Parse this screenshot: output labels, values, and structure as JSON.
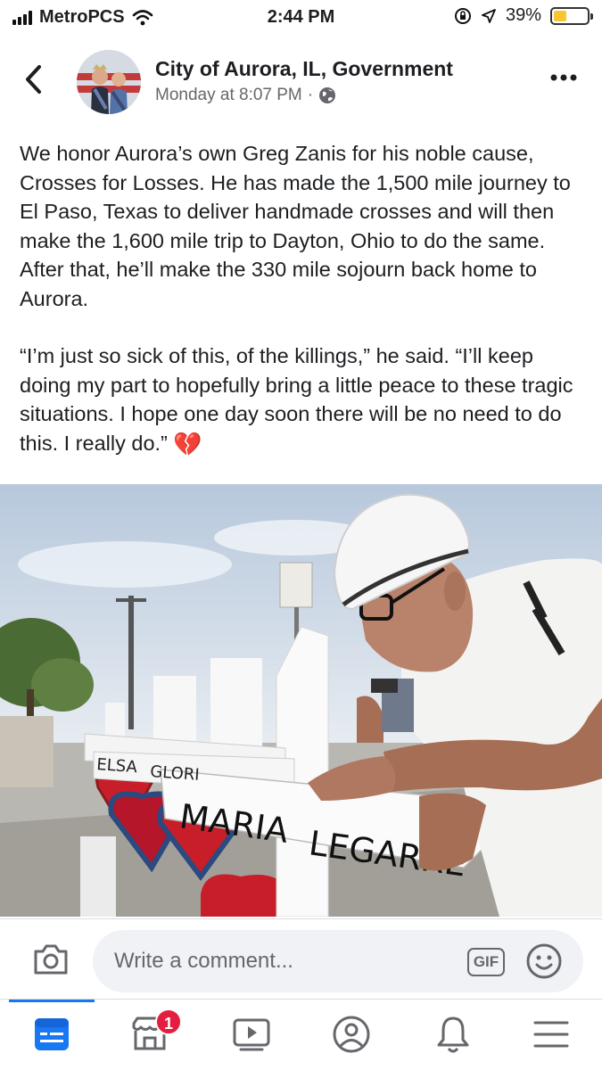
{
  "status_bar": {
    "carrier": "MetroPCS",
    "time": "2:44 PM",
    "battery": "39%",
    "battery_level": 0.39,
    "icons": [
      "signal-icon",
      "wifi-icon",
      "orientation-lock-icon",
      "location-icon",
      "battery-icon"
    ]
  },
  "header": {
    "page_name": "City of Aurora, IL, Government",
    "timestamp": "Monday at 8:07 PM",
    "separator": "·",
    "icons": [
      "back-chevron-icon",
      "globe-icon",
      "more-dots-icon"
    ]
  },
  "post": {
    "paragraph_1": "We honor Aurora’s own Greg Zanis for his noble cause, Crosses for Losses. He has made the 1,500 mile journey to El Paso, Texas to deliver handmade crosses and will then make the 1,600 mile trip to Dayton, Ohio to do the same.  After that, he’ll make the 330 mile sojourn back home to Aurora.",
    "paragraph_2": "“I’m just so sick of this, of the killings,” he said. “I’ll keep doing my part to hopefully bring a little peace to these tragic situations. I hope one day soon there will be no need to do this. I really do.”",
    "emoji": "💔",
    "photo_text": {
      "cross_name_1": "MARIA",
      "cross_name_2": "LEGARRE",
      "cross_small_1": "ELSA",
      "cross_small_2": "GLORI"
    }
  },
  "comment_bar": {
    "placeholder": "Write a comment...",
    "gif_label": "GIF"
  },
  "tab_bar": {
    "active_tab": "news-feed",
    "marketplace_badge": "1",
    "tabs": [
      "news-feed-icon",
      "marketplace-icon",
      "watch-icon",
      "profile-icon",
      "notifications-icon",
      "menu-icon"
    ]
  },
  "colors": {
    "accent": "#1877f2",
    "badge": "#e41e3f",
    "battery": "#f7c632",
    "text": "#1c1e21",
    "secondary_text": "#65676b"
  }
}
